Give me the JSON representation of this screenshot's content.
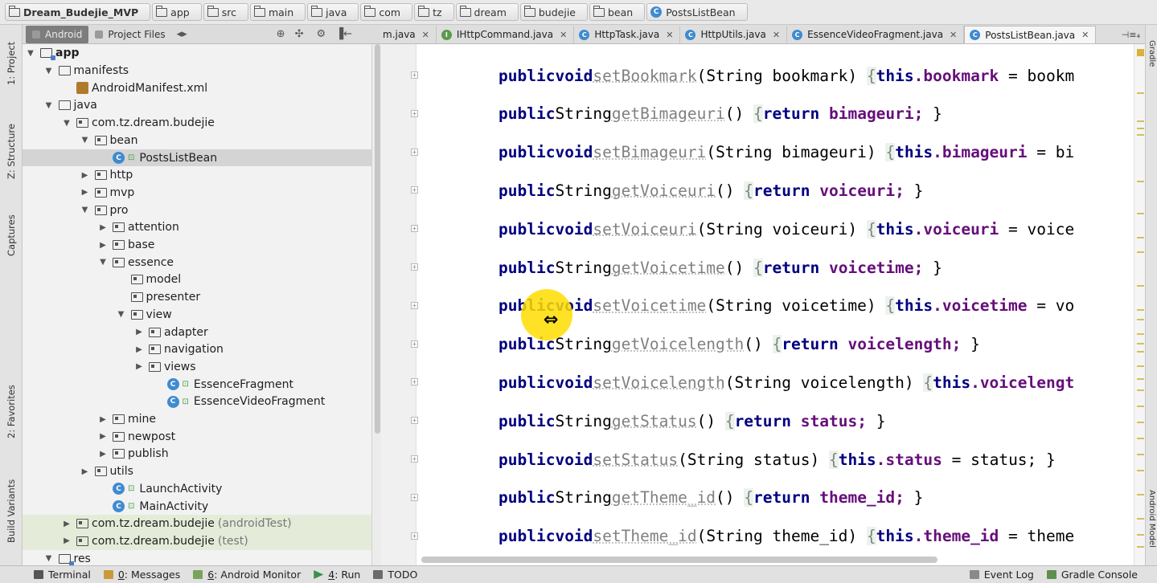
{
  "breadcrumb": [
    {
      "label": "Dream_Budejie_MVP",
      "kind": "module"
    },
    {
      "label": "app",
      "kind": "folder"
    },
    {
      "label": "src",
      "kind": "folder"
    },
    {
      "label": "main",
      "kind": "folder"
    },
    {
      "label": "java",
      "kind": "folder"
    },
    {
      "label": "com",
      "kind": "folder"
    },
    {
      "label": "tz",
      "kind": "folder"
    },
    {
      "label": "dream",
      "kind": "folder"
    },
    {
      "label": "budejie",
      "kind": "folder"
    },
    {
      "label": "bean",
      "kind": "folder"
    },
    {
      "label": "PostsListBean",
      "kind": "class"
    }
  ],
  "left_stripe": {
    "project": "1: Project",
    "structure": "Z: Structure",
    "captures": "Captures",
    "favorites": "2: Favorites",
    "build_variants": "Build Variants"
  },
  "right_stripe": {
    "gradle": "Gradle",
    "android_model": "Android Model"
  },
  "panel_header": {
    "android_tab": "Android",
    "project_files_tab": "Project Files",
    "switch_icon": "◂▸",
    "target_icon": "⊕",
    "collapse_icon": "✣",
    "settings_icon": "⚙",
    "hide_icon": "▐←"
  },
  "tree": [
    {
      "label": "app",
      "depth": 0,
      "arrow": "down",
      "icon": "module",
      "bold": true
    },
    {
      "label": "manifests",
      "depth": 1,
      "arrow": "down",
      "icon": "folder"
    },
    {
      "label": "AndroidManifest.xml",
      "depth": 2,
      "arrow": "none",
      "icon": "xml"
    },
    {
      "label": "java",
      "depth": 1,
      "arrow": "down",
      "icon": "folder"
    },
    {
      "label": "com.tz.dream.budejie",
      "depth": 2,
      "arrow": "down",
      "icon": "package"
    },
    {
      "label": "bean",
      "depth": 3,
      "arrow": "down",
      "icon": "package"
    },
    {
      "label": "PostsListBean",
      "depth": 4,
      "arrow": "none",
      "icon": "class",
      "selected": true
    },
    {
      "label": "http",
      "depth": 3,
      "arrow": "right",
      "icon": "package"
    },
    {
      "label": "mvp",
      "depth": 3,
      "arrow": "right",
      "icon": "package"
    },
    {
      "label": "pro",
      "depth": 3,
      "arrow": "down",
      "icon": "package"
    },
    {
      "label": "attention",
      "depth": 4,
      "arrow": "right",
      "icon": "package"
    },
    {
      "label": "base",
      "depth": 4,
      "arrow": "right",
      "icon": "package"
    },
    {
      "label": "essence",
      "depth": 4,
      "arrow": "down",
      "icon": "package"
    },
    {
      "label": "model",
      "depth": 5,
      "arrow": "none",
      "icon": "package"
    },
    {
      "label": "presenter",
      "depth": 5,
      "arrow": "none",
      "icon": "package"
    },
    {
      "label": "view",
      "depth": 5,
      "arrow": "down",
      "icon": "package"
    },
    {
      "label": "adapter",
      "depth": 6,
      "arrow": "right",
      "icon": "package"
    },
    {
      "label": "navigation",
      "depth": 6,
      "arrow": "right",
      "icon": "package"
    },
    {
      "label": "views",
      "depth": 6,
      "arrow": "right",
      "icon": "package"
    },
    {
      "label": "EssenceFragment",
      "depth": 7,
      "arrow": "none",
      "icon": "class"
    },
    {
      "label": "EssenceVideoFragment",
      "depth": 7,
      "arrow": "none",
      "icon": "class"
    },
    {
      "label": "mine",
      "depth": 4,
      "arrow": "right",
      "icon": "package"
    },
    {
      "label": "newpost",
      "depth": 4,
      "arrow": "right",
      "icon": "package"
    },
    {
      "label": "publish",
      "depth": 4,
      "arrow": "right",
      "icon": "package"
    },
    {
      "label": "utils",
      "depth": 3,
      "arrow": "right",
      "icon": "package"
    },
    {
      "label": "LaunchActivity",
      "depth": 4,
      "arrow": "none",
      "icon": "class"
    },
    {
      "label": "MainActivity",
      "depth": 4,
      "arrow": "none",
      "icon": "class"
    },
    {
      "label": "com.tz.dream.budejie",
      "suffix": "(androidTest)",
      "depth": 2,
      "arrow": "right",
      "icon": "package",
      "test": true
    },
    {
      "label": "com.tz.dream.budejie",
      "suffix": "(test)",
      "depth": 2,
      "arrow": "right",
      "icon": "package",
      "test": true
    },
    {
      "label": "res",
      "depth": 1,
      "arrow": "down",
      "icon": "module"
    }
  ],
  "editor_tabs": [
    {
      "label": "m.java",
      "icon": "none",
      "active": false
    },
    {
      "label": "IHttpCommand.java",
      "icon": "interface",
      "active": false
    },
    {
      "label": "HttpTask.java",
      "icon": "class",
      "active": false
    },
    {
      "label": "HttpUtils.java",
      "icon": "class",
      "active": false
    },
    {
      "label": "EssenceVideoFragment.java",
      "icon": "class",
      "active": false
    },
    {
      "label": "PostsListBean.java",
      "icon": "class",
      "active": true
    }
  ],
  "tabs_overflow": "⊣≡₄",
  "code_lines": [
    {
      "ret": "void",
      "name": "setBookmark",
      "params": "String bookmark",
      "body": "this.bookmark = bookm"
    },
    {
      "ret": "String",
      "name": "getBimageuri",
      "params": "",
      "body": "return bimageuri; }"
    },
    {
      "ret": "void",
      "name": "setBimageuri",
      "params": "String bimageuri",
      "body": "this.bimageuri = bi"
    },
    {
      "ret": "String",
      "name": "getVoiceuri",
      "params": "",
      "body": "return voiceuri; }"
    },
    {
      "ret": "void",
      "name": "setVoiceuri",
      "params": "String voiceuri",
      "body": "this.voiceuri = voice"
    },
    {
      "ret": "String",
      "name": "getVoicetime",
      "params": "",
      "body": "return voicetime; }"
    },
    {
      "ret": "void",
      "name": "setVoicetime",
      "params": "String voicetime",
      "body": "this.voicetime = vo"
    },
    {
      "ret": "String",
      "name": "getVoicelength",
      "params": "",
      "body": "return voicelength; }"
    },
    {
      "ret": "void",
      "name": "setVoicelength",
      "params": "String voicelength",
      "body": "this.voicelengt"
    },
    {
      "ret": "String",
      "name": "getStatus",
      "params": "",
      "body": "return status; }"
    },
    {
      "ret": "void",
      "name": "setStatus",
      "params": "String status",
      "body": "this.status = status; }"
    },
    {
      "ret": "String",
      "name": "getTheme_id",
      "params": "",
      "body": "return theme_id; }"
    },
    {
      "ret": "void",
      "name": "setTheme_id",
      "params": "String theme_id",
      "body": "this.theme_id = theme"
    }
  ],
  "keyword_public": "public",
  "bottom_bar": {
    "terminal": "Terminal",
    "messages_key": "0",
    "messages": ": Messages",
    "android_monitor_key": "6",
    "android_monitor": ": Android Monitor",
    "run_key": "4",
    "run": ": Run",
    "todo": "TODO",
    "event_log": "Event Log",
    "gradle_console": "Gradle Console"
  },
  "colors": {
    "keyword": "#000080",
    "field": "#660e7a",
    "method": "#808080",
    "class_icon": "#3f8bd0",
    "cursor_highlight": "#ffdd00"
  }
}
